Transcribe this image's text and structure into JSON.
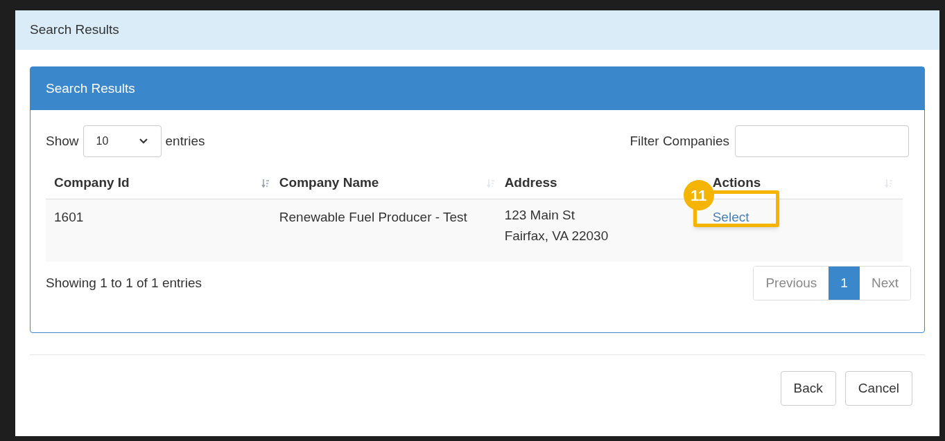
{
  "dialog": {
    "title": "Search Results"
  },
  "panel": {
    "title": "Search Results",
    "length": {
      "label_before": "Show",
      "value": "10",
      "label_after": "entries"
    },
    "filter": {
      "label": "Filter Companies"
    },
    "table": {
      "columns": [
        {
          "label": "Company Id",
          "sorted": true
        },
        {
          "label": "Company Name",
          "sorted": false
        },
        {
          "label": "Address",
          "sorted": false
        },
        {
          "label": "Actions",
          "sorted": false
        }
      ],
      "rows": [
        {
          "company_id": "1601",
          "company_name": "Renewable Fuel Producer - Test",
          "address_lines": [
            "123 Main St",
            "Fairfax, VA 22030"
          ],
          "action": "Select",
          "callout": "11"
        }
      ]
    },
    "info": "Showing 1 to 1 of 1 entries",
    "pagination": [
      {
        "label": "Previous",
        "selected": false
      },
      {
        "label": "1",
        "selected": true
      },
      {
        "label": "Next",
        "selected": false
      }
    ]
  },
  "buttons": [
    "Back",
    "Cancel"
  ]
}
